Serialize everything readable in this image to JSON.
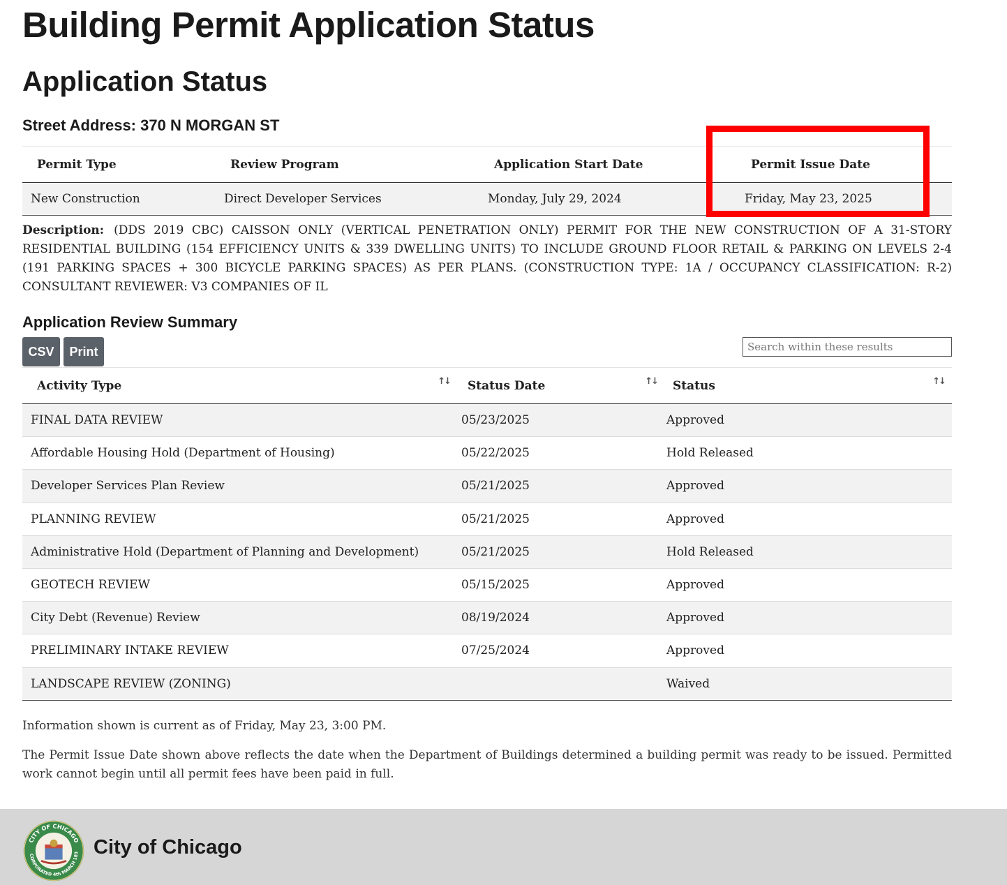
{
  "page_title": "Building Permit Application Status",
  "section_title": "Application Status",
  "street_address": "Street Address: 370 N MORGAN ST",
  "permit_table": {
    "headers": [
      "Permit Type",
      "Review Program",
      "Application Start Date",
      "Permit Issue Date"
    ],
    "row": [
      "New Construction",
      "Direct Developer Services",
      "Monday, July 29, 2024",
      "Friday, May 23, 2025"
    ]
  },
  "description": {
    "label": "Description:",
    "text": "(DDS 2019 CBC) CAISSON ONLY (VERTICAL PENETRATION ONLY) PERMIT FOR THE NEW CONSTRUCTION OF A 31-STORY RESIDENTIAL BUILDING (154 EFFICIENCY UNITS & 339 DWELLING UNITS) TO INCLUDE GROUND FLOOR RETAIL & PARKING ON LEVELS 2-4 (191 PARKING SPACES + 300 BICYCLE PARKING SPACES) AS PER PLANS. (CONSTRUCTION TYPE: 1A / OCCUPANCY CLASSIFICATION: R-2) CONSULTANT REVIEWER: V3 COMPANIES OF IL"
  },
  "review_summary": {
    "heading": "Application Review Summary",
    "csv_label": "CSV",
    "print_label": "Print",
    "search_placeholder": "Search within these results",
    "headers": [
      "Activity Type",
      "Status Date",
      "Status"
    ],
    "sort_glyph": "↑↓",
    "rows": [
      [
        "FINAL DATA REVIEW",
        "05/23/2025",
        "Approved"
      ],
      [
        "Affordable Housing Hold (Department of Housing)",
        "05/22/2025",
        "Hold Released"
      ],
      [
        "Developer Services Plan Review",
        "05/21/2025",
        "Approved"
      ],
      [
        "PLANNING REVIEW",
        "05/21/2025",
        "Approved"
      ],
      [
        "Administrative Hold (Department of Planning and Development)",
        "05/21/2025",
        "Hold Released"
      ],
      [
        "GEOTECH REVIEW",
        "05/15/2025",
        "Approved"
      ],
      [
        "City Debt (Revenue) Review",
        "08/19/2024",
        "Approved"
      ],
      [
        "PRELIMINARY INTAKE REVIEW",
        "07/25/2024",
        "Approved"
      ],
      [
        "LANDSCAPE REVIEW (ZONING)",
        "",
        "Waived"
      ]
    ]
  },
  "info_current": "Information shown is current as of Friday, May 23, 3:00 PM.",
  "info_note": "The Permit Issue Date shown above reflects the date when the Department of Buildings determined a building permit was ready to be issued. Permitted work cannot begin until all permit fees have been paid in full.",
  "footer": {
    "title": "City of Chicago",
    "seal_icon": "city-of-chicago-seal",
    "seal_text_top": "CITY OF CHICAGO",
    "seal_text_bottom": "INCORPORATED 4th MARCH 1837"
  },
  "colors": {
    "highlight": "#ff0000",
    "button_bg": "#5a6169",
    "footer_bg": "#d6d6d6",
    "row_stripe": "#f2f2f2",
    "seal_green": "#3a8a4a"
  }
}
